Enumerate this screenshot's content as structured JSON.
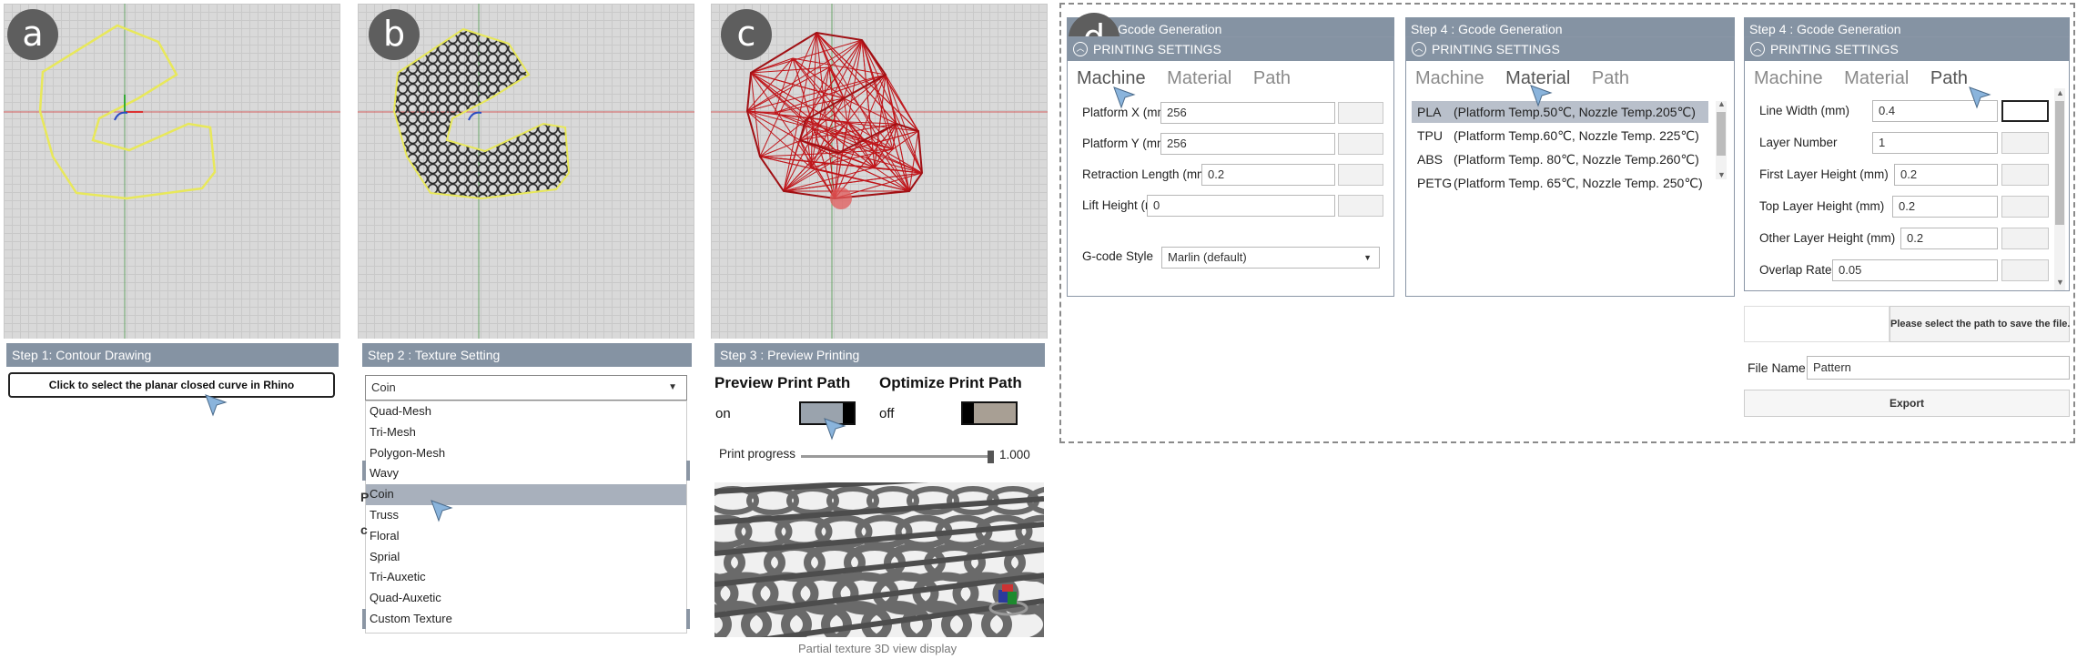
{
  "badges": {
    "a": "a",
    "b": "b",
    "c": "c",
    "d": "d"
  },
  "step1": {
    "title": "Step 1: Contour Drawing",
    "button_label": "Click to select the planar closed curve in Rhino"
  },
  "step2": {
    "title": "Step 2 : Texture Setting",
    "selected": "Coin",
    "options": [
      "Quad-Mesh",
      "Tri-Mesh",
      "Polygon-Mesh",
      "Wavy",
      "Coin",
      "Truss",
      "Floral",
      "Sprial",
      "Tri-Auxetic",
      "Quad-Auxetic",
      "Custom Texture"
    ],
    "side_glyph_1": "P",
    "side_glyph_2": "c"
  },
  "step3": {
    "title": "Step 3 : Preview Printing",
    "preview_label": "Preview Print Path",
    "preview_state": "on",
    "optimize_label": "Optimize Print Path",
    "optimize_state": "off",
    "progress_label": "Print progress",
    "progress_value_text": "1.000",
    "progress_value": 1.0,
    "caption": "Partial texture 3D view display"
  },
  "step4": {
    "title": "Step 4 : Gcode Generation",
    "title_partial": "Gcode Generation",
    "section": "PRINTING SETTINGS",
    "tabs": [
      "Machine",
      "Material",
      "Path"
    ],
    "machine": {
      "fields": [
        {
          "label": "Platform X (mm)",
          "value": "256"
        },
        {
          "label": "Platform Y (mm)",
          "value": "256"
        },
        {
          "label": "Retraction Length (mm)",
          "value": "0.2"
        },
        {
          "label": "Lift Height (mm)",
          "value": "0"
        }
      ],
      "gcode_style_label": "G-code Style",
      "gcode_style_value": "Marlin  (default)"
    },
    "material": {
      "items": [
        {
          "name": "PLA",
          "desc": "(Platform Temp.50℃, Nozzle Temp.205℃)"
        },
        {
          "name": "TPU",
          "desc": "(Platform Temp.60℃, Nozzle Temp. 225℃)"
        },
        {
          "name": "ABS",
          "desc": "(Platform Temp. 80℃, Nozzle Temp.260℃)"
        },
        {
          "name": "PETG",
          "desc": "(Platform Temp. 65℃, Nozzle Temp. 250℃)"
        }
      ]
    },
    "path": {
      "fields": [
        {
          "label": "Line Width (mm)",
          "value": "0.4"
        },
        {
          "label": "Layer Number",
          "value": "1"
        },
        {
          "label": "First Layer Height (mm)",
          "value": "0.2"
        },
        {
          "label": "Top Layer Height (mm)",
          "value": "0.2"
        },
        {
          "label": "Other Layer Height (mm)",
          "value": "0.2"
        },
        {
          "label": "Overlap Rate",
          "value": "0.05"
        }
      ]
    },
    "save_path_button": "Please select the path to save the file.",
    "file_name_label": "File Name",
    "file_name_value": "Pattern",
    "export_button": "Export"
  },
  "colors": {
    "step_bar": "#8593a3",
    "curve_yellow": "#e8e85a",
    "path_red": "#c0161b",
    "selection": "#a8b0bc"
  }
}
